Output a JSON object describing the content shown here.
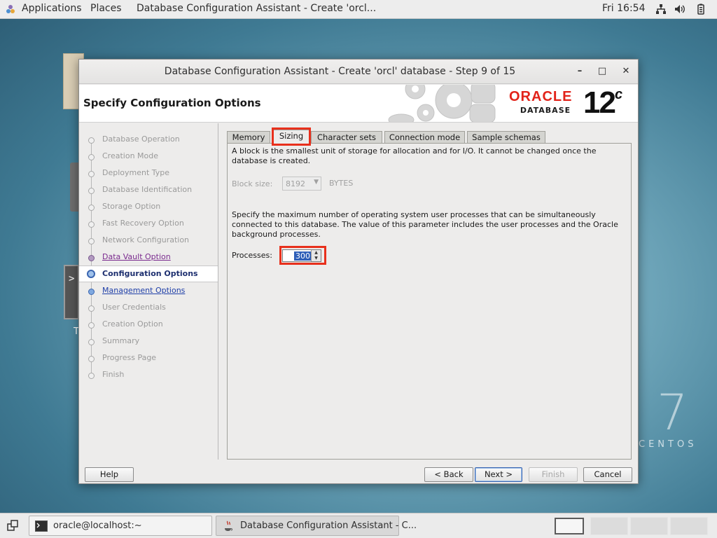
{
  "topbar": {
    "applications": "Applications",
    "places": "Places",
    "active_window": "Database Configuration Assistant - Create 'orcl...",
    "clock": "Fri 16:54"
  },
  "desktop": {
    "brand_number": "7",
    "brand_text": "CENTOS",
    "icon_label_fragment": "T"
  },
  "window": {
    "title": "Database Configuration Assistant - Create 'orcl' database - Step 9 of 15",
    "header_title": "Specify Configuration Options",
    "logo_oracle": "ORACLE",
    "logo_database": "DATABASE",
    "logo_version": "12",
    "logo_version_suffix": "c"
  },
  "steps": [
    {
      "label": "Database Operation",
      "state": "done"
    },
    {
      "label": "Creation Mode",
      "state": "done"
    },
    {
      "label": "Deployment Type",
      "state": "done"
    },
    {
      "label": "Database Identification",
      "state": "done"
    },
    {
      "label": "Storage Option",
      "state": "done"
    },
    {
      "label": "Fast Recovery Option",
      "state": "done"
    },
    {
      "label": "Network Configuration",
      "state": "done"
    },
    {
      "label": "Data Vault Option",
      "state": "visited"
    },
    {
      "label": "Configuration Options",
      "state": "current"
    },
    {
      "label": "Management Options",
      "state": "next"
    },
    {
      "label": "User Credentials",
      "state": "pending"
    },
    {
      "label": "Creation Option",
      "state": "pending"
    },
    {
      "label": "Summary",
      "state": "pending"
    },
    {
      "label": "Progress Page",
      "state": "pending"
    },
    {
      "label": "Finish",
      "state": "pending"
    }
  ],
  "tabs": {
    "memory": "Memory",
    "sizing": "Sizing",
    "character_sets": "Character sets",
    "connection_mode": "Connection mode",
    "sample_schemas": "Sample schemas",
    "active": "Sizing"
  },
  "sizing": {
    "block_desc": "A block is the smallest unit of storage for allocation and for I/O. It cannot be changed once the database is created.",
    "block_size_label": "Block size:",
    "block_size_value": "8192",
    "block_size_unit": "BYTES",
    "processes_desc": "Specify the maximum number of operating system user processes that can be simultaneously connected to this database. The value of this parameter includes the user processes and the Oracle background processes.",
    "processes_label": "Processes:",
    "processes_value": "300"
  },
  "buttons": {
    "help": "Help",
    "back": "< Back",
    "next": "Next >",
    "finish": "Finish",
    "cancel": "Cancel"
  },
  "taskbar": {
    "terminal": "oracle@localhost:~",
    "dbca": "Database Configuration Assistant - C..."
  },
  "colors": {
    "highlight_box": "#e8301c",
    "oracle_red": "#e2231a",
    "current_step_text": "#1d2f6f",
    "visited_link": "#7a2a8e",
    "next_link": "#1f3fa8"
  }
}
